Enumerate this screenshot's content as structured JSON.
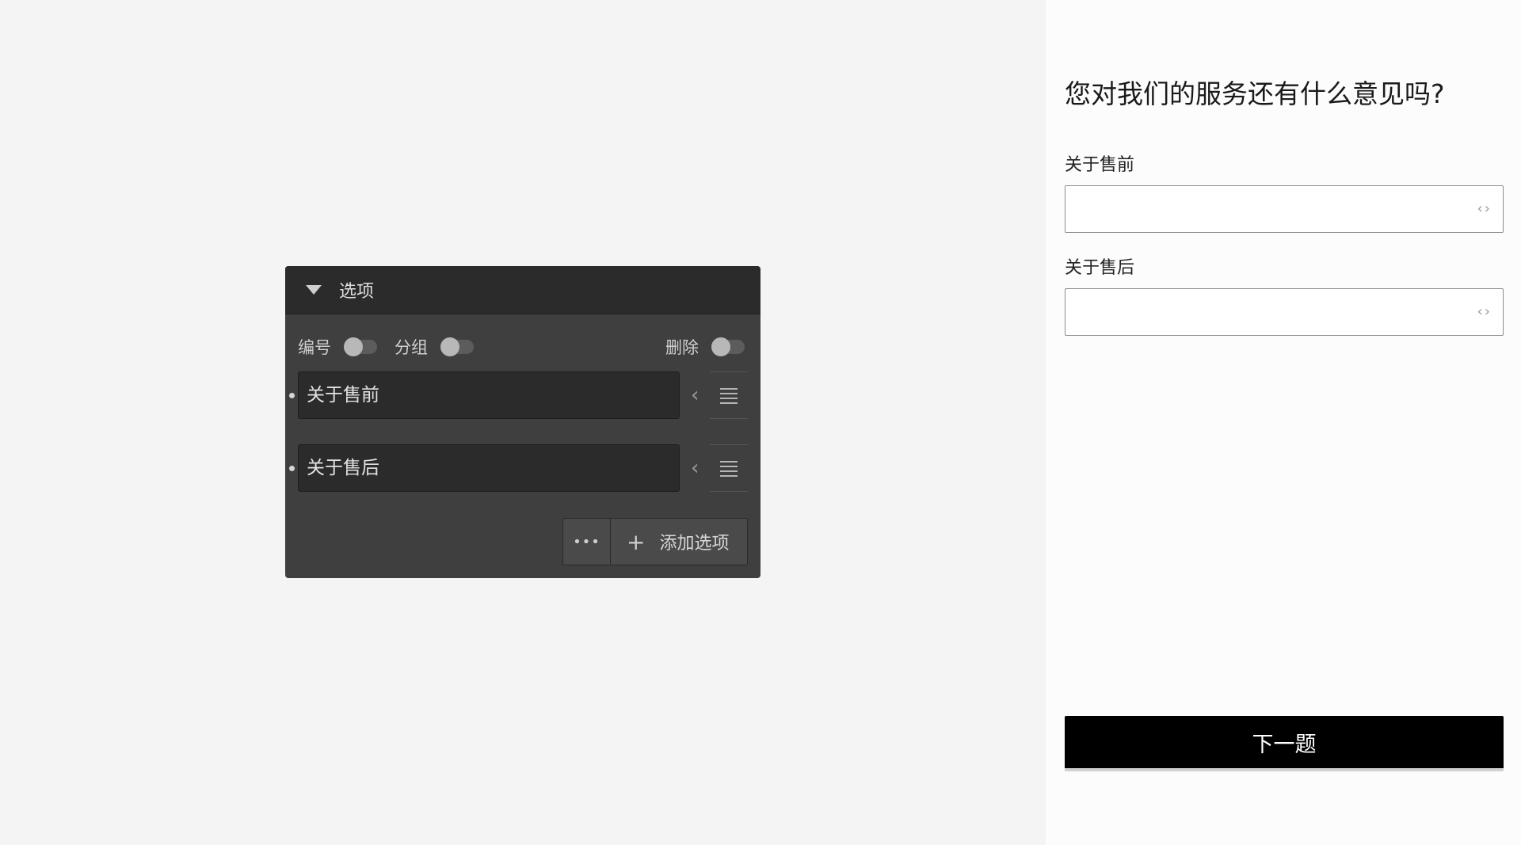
{
  "panel": {
    "title": "选项",
    "toggles": {
      "number_label": "编号",
      "group_label": "分组",
      "delete_label": "删除"
    },
    "options": [
      {
        "label": "关于售前"
      },
      {
        "label": "关于售后"
      }
    ],
    "more_label": "•••",
    "add_label": "添加选项",
    "add_icon": "+"
  },
  "preview": {
    "question": "您对我们的服务还有什么意见吗?",
    "fields": [
      {
        "label": "关于售前",
        "value": ""
      },
      {
        "label": "关于售后",
        "value": ""
      }
    ],
    "code_icon": "‹›",
    "next_label": "下一题"
  },
  "colors": {
    "panel_bg": "#3f3f3f",
    "panel_header_bg": "#2b2b2b",
    "preview_bg": "#fcfcfc",
    "button_bg": "#000000"
  }
}
